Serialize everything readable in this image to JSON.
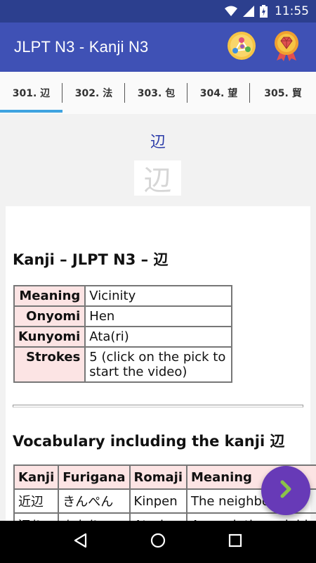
{
  "status_bar": {
    "time": "11:55",
    "icons": [
      "wifi-icon",
      "signal-icon",
      "battery-icon"
    ]
  },
  "app_bar": {
    "title": "JLPT N3 - Kanji N3",
    "actions": [
      "quiz-icon",
      "badge-icon"
    ]
  },
  "tabs": [
    {
      "label": "301. 辺",
      "selected": true
    },
    {
      "label": "302. 法",
      "selected": false
    },
    {
      "label": "303. 包",
      "selected": false
    },
    {
      "label": "304. 望",
      "selected": false
    },
    {
      "label": "305. 貿",
      "selected": false
    }
  ],
  "colors": {
    "status_bar": "#2c3f8e",
    "app_bar": "#3f51b5",
    "tab_indicator": "#3fa3e0",
    "fab": "#673ab7",
    "fab_arrow": "#8bc34a",
    "label_bg": "#fce4e4",
    "heading": "#2a3aa8"
  },
  "kanji": {
    "heading": "辺",
    "image_glyph": "辺"
  },
  "card": {
    "title": "Kanji – JLPT N3 – 辺",
    "info": [
      {
        "label": "Meaning",
        "value": "Vicinity"
      },
      {
        "label": "Onyomi",
        "value": "Hen"
      },
      {
        "label": "Kunyomi",
        "value": "Ata(ri)"
      },
      {
        "label": "Strokes",
        "value": "5 (click on the pick to start the video)"
      }
    ],
    "vocab_title": "Vocabulary including the kanji 辺",
    "vocab_headers": [
      "Kanji",
      "Furigana",
      "Romaji",
      "Meaning"
    ],
    "vocab_rows": [
      [
        "近辺",
        "きんぺん",
        "Kinpen",
        "The neighborhood"
      ],
      [
        "辺り",
        "あたり",
        "Atari",
        "Around, the neighborhood"
      ]
    ]
  },
  "fab": {
    "icon": "chevron-right-icon"
  },
  "nav": {
    "buttons": [
      "back-icon",
      "home-icon",
      "recents-icon"
    ]
  }
}
